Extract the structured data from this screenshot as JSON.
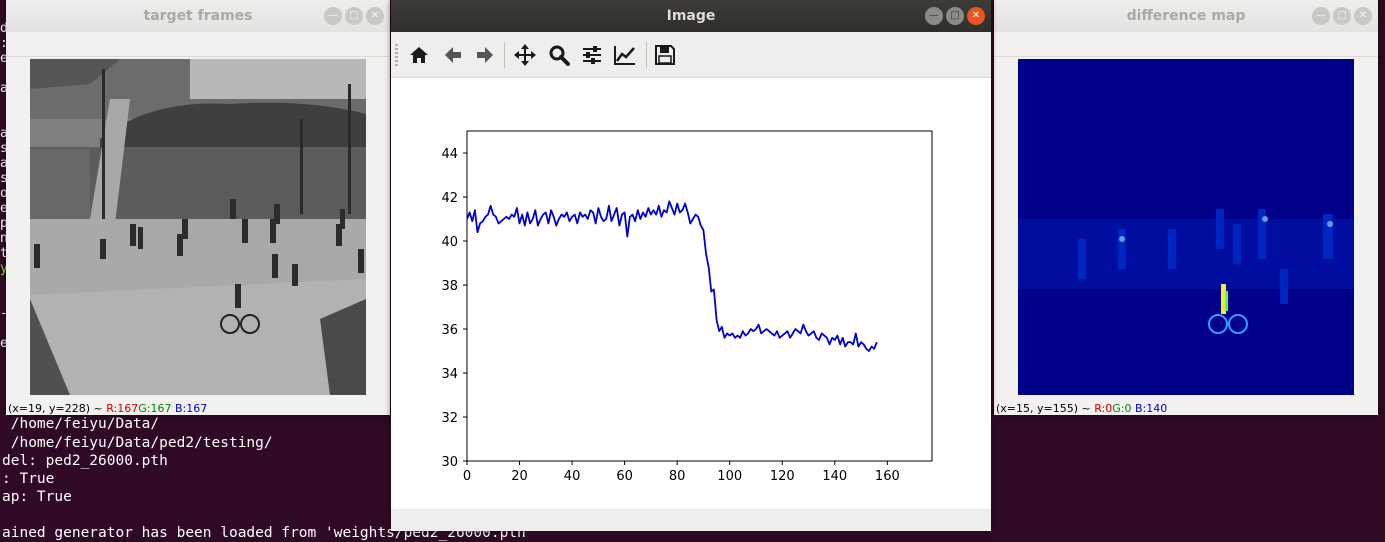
{
  "terminal": {
    "lines": [
      " /home/feiyu/Data/",
      " /home/feiyu/Data/ped2/testing/",
      "del: ped2_26000.pth",
      ": True",
      "ap: True",
      "",
      "ained generator has been loaded from 'weights/ped2_26000.pth"
    ],
    "edge_chars": [
      "d",
      ":",
      "e",
      "",
      "a",
      "",
      "",
      "a",
      "s",
      "a",
      "s",
      "o",
      "e",
      "p",
      "n",
      "t",
      "y",
      "",
      "",
      "-",
      "",
      "e"
    ]
  },
  "windows": {
    "target": {
      "title": "target frames",
      "status": {
        "coords": "(x=19, y=228) ~",
        "r": "R:167",
        "g": "G:167",
        "b": "B:167"
      }
    },
    "image": {
      "title": "Image",
      "toolbar": [
        {
          "name": "home-icon",
          "tooltip": "Home"
        },
        {
          "name": "back-arrow-icon",
          "tooltip": "Back"
        },
        {
          "name": "forward-arrow-icon",
          "tooltip": "Forward"
        },
        {
          "name": "pan-icon",
          "tooltip": "Pan"
        },
        {
          "name": "zoom-icon",
          "tooltip": "Zoom"
        },
        {
          "name": "configure-subplots-icon",
          "tooltip": "Subplots"
        },
        {
          "name": "edit-axis-icon",
          "tooltip": "Customize"
        },
        {
          "name": "save-icon",
          "tooltip": "Save"
        }
      ]
    },
    "diff": {
      "title": "difference map",
      "status": {
        "coords": "(x=15, y=155) ~",
        "r": "R:0",
        "g": "G:0",
        "b": "B:140"
      }
    }
  },
  "chart_data": {
    "type": "line",
    "title": "",
    "xlabel": "",
    "ylabel": "",
    "xlim": [
      0,
      177
    ],
    "ylim": [
      30,
      45
    ],
    "xticks": [
      0,
      20,
      40,
      60,
      80,
      100,
      120,
      140,
      160
    ],
    "yticks": [
      30,
      32,
      34,
      36,
      38,
      40,
      42,
      44
    ],
    "grid": false,
    "color": "#0000cc",
    "series": [
      {
        "x": [
          0,
          1,
          2,
          3,
          4,
          5,
          6,
          7,
          8,
          9,
          10,
          11,
          12,
          13,
          14,
          15,
          16,
          17,
          18,
          19,
          20,
          21,
          22,
          23,
          24,
          25,
          26,
          27,
          28,
          29,
          30,
          31,
          32,
          33,
          34,
          35,
          36,
          37,
          38,
          39,
          40,
          41,
          42,
          43,
          44,
          45,
          46,
          47,
          48,
          49,
          50,
          51,
          52,
          53,
          54,
          55,
          56,
          57,
          58,
          59,
          60,
          61,
          62,
          63,
          64,
          65,
          66,
          67,
          68,
          69,
          70,
          71,
          72,
          73,
          74,
          75,
          76,
          77,
          78,
          79,
          80,
          81,
          82,
          83,
          84,
          85,
          86,
          87,
          88,
          89,
          90,
          91,
          92,
          93,
          94,
          95,
          96,
          97,
          98,
          99,
          100,
          101,
          102,
          103,
          104,
          105,
          106,
          107,
          108,
          109,
          110,
          111,
          112,
          113,
          114,
          115,
          116,
          117,
          118,
          119,
          120,
          121,
          122,
          123,
          124,
          125,
          126,
          127,
          128,
          129,
          130,
          131,
          132,
          133,
          134,
          135,
          136,
          137,
          138,
          139,
          140,
          141,
          142,
          143,
          144,
          145,
          146,
          147,
          148,
          149,
          150,
          151,
          152,
          153,
          154,
          155,
          156
        ],
        "y": [
          41.0,
          41.3,
          40.9,
          41.4,
          40.4,
          40.8,
          40.9,
          41.1,
          41.2,
          41.6,
          41.2,
          41.1,
          40.8,
          40.9,
          41.0,
          41.1,
          41.0,
          41.2,
          41.1,
          41.5,
          40.8,
          41.2,
          40.7,
          41.3,
          40.8,
          41.0,
          41.4,
          40.7,
          41.0,
          41.2,
          41.3,
          40.8,
          41.4,
          41.1,
          40.7,
          41.0,
          41.2,
          41.1,
          41.3,
          40.9,
          41.1,
          41.2,
          40.8,
          41.3,
          41.1,
          41.2,
          41.0,
          41.4,
          41.3,
          40.8,
          41.5,
          41.1,
          40.9,
          41.0,
          41.6,
          40.9,
          41.2,
          41.5,
          40.7,
          41.2,
          41.3,
          40.2,
          41.1,
          41.2,
          40.9,
          41.4,
          41.0,
          41.3,
          41.1,
          41.5,
          41.2,
          41.4,
          41.2,
          41.6,
          41.1,
          41.4,
          41.3,
          41.8,
          41.5,
          41.2,
          41.7,
          41.3,
          41.4,
          41.7,
          41.3,
          40.8,
          41.0,
          41.2,
          41.1,
          40.7,
          40.5,
          39.4,
          38.8,
          37.7,
          37.8,
          36.4,
          35.9,
          36.1,
          35.6,
          35.8,
          35.7,
          35.8,
          35.6,
          35.7,
          35.6,
          35.9,
          35.7,
          35.8,
          36.0,
          35.9,
          36.0,
          36.2,
          35.8,
          35.9,
          36.0,
          35.9,
          35.8,
          35.7,
          35.9,
          35.6,
          35.7,
          35.8,
          35.9,
          35.6,
          35.8,
          36.0,
          35.9,
          35.8,
          36.2,
          35.9,
          35.7,
          35.8,
          35.9,
          35.6,
          35.5,
          35.8,
          35.7,
          35.6,
          35.3,
          35.6,
          35.5,
          35.7,
          35.3,
          35.6,
          35.2,
          35.4,
          35.4,
          35.3,
          35.8,
          35.2,
          35.4,
          35.3,
          35.1,
          35.0,
          35.2,
          35.1,
          35.4
        ]
      }
    ]
  }
}
